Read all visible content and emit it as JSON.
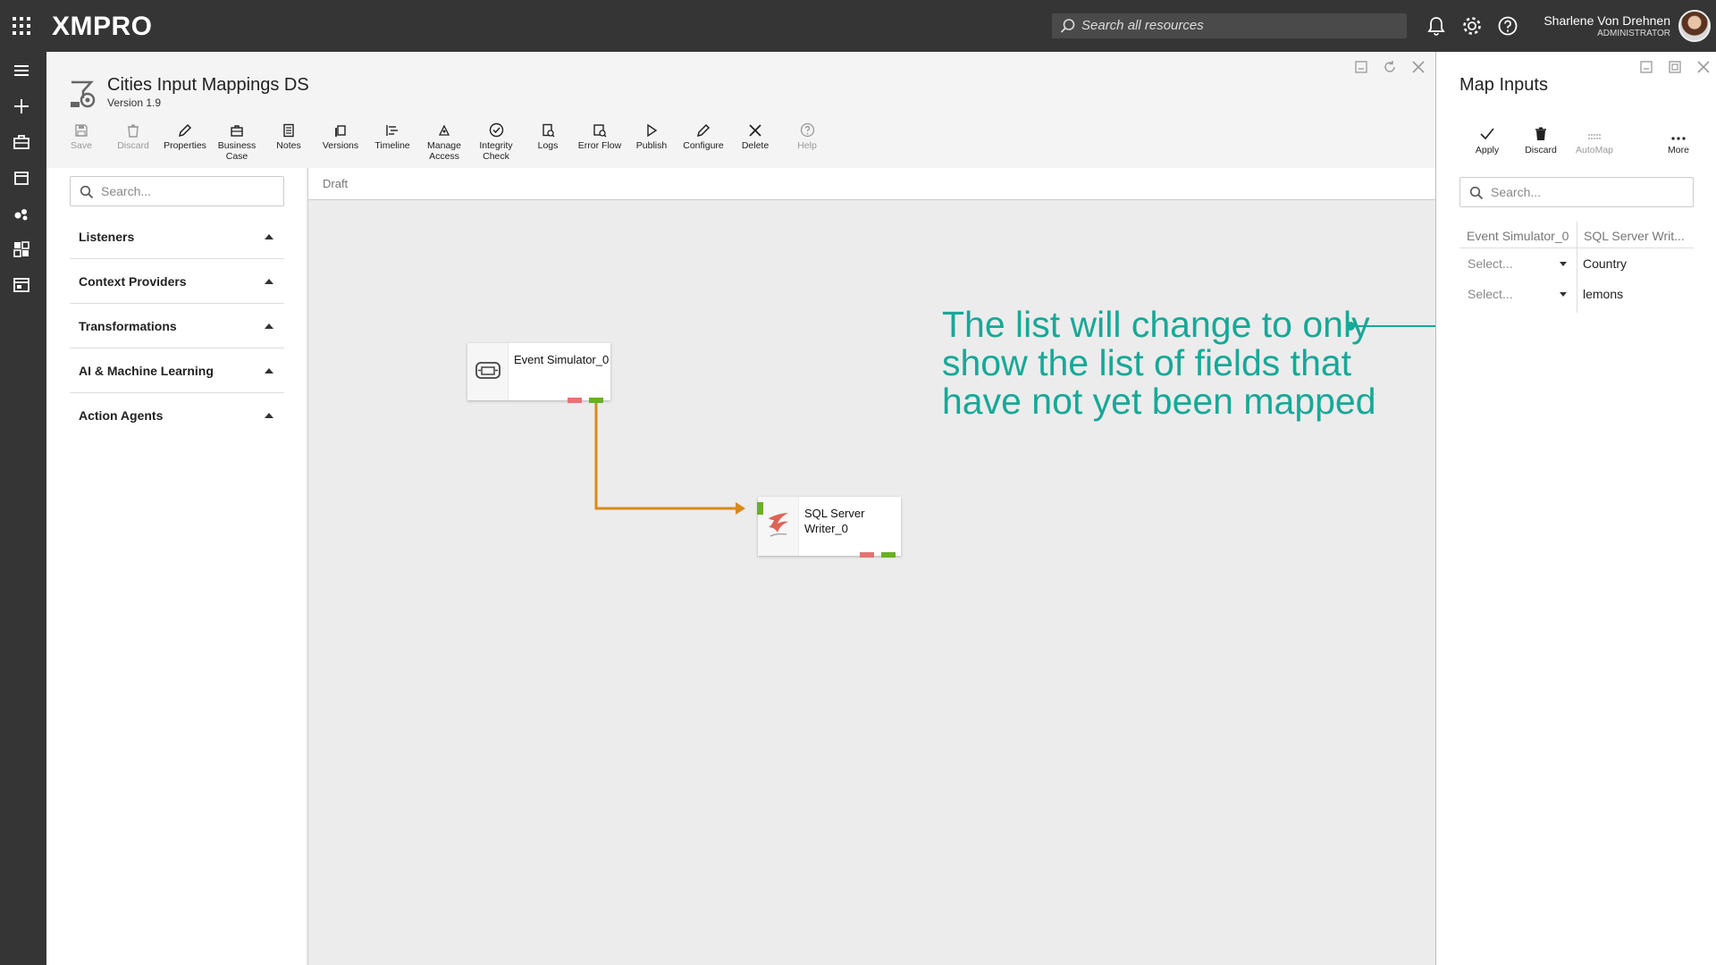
{
  "topbar": {
    "brand": "XMPRO",
    "search_placeholder": "Search all resources",
    "user_name": "Sharlene Von Drehnen",
    "user_role": "ADMINISTRATOR"
  },
  "datastream": {
    "title": "Cities Input Mappings DS",
    "version": "Version 1.9"
  },
  "toolbar": [
    {
      "label": "Save",
      "icon": "save-icon",
      "enabled": false
    },
    {
      "label": "Discard",
      "icon": "trash-icon",
      "enabled": false
    },
    {
      "label": "Properties",
      "icon": "pencil-icon",
      "enabled": true
    },
    {
      "label": "Business Case",
      "icon": "briefcase-icon",
      "enabled": true
    },
    {
      "label": "Notes",
      "icon": "notes-icon",
      "enabled": true
    },
    {
      "label": "Versions",
      "icon": "versions-icon",
      "enabled": true
    },
    {
      "label": "Timeline",
      "icon": "timeline-icon",
      "enabled": true
    },
    {
      "label": "Manage Access",
      "icon": "access-icon",
      "enabled": true
    },
    {
      "label": "Integrity Check",
      "icon": "check-circle-icon",
      "enabled": true
    },
    {
      "label": "Logs",
      "icon": "logs-icon",
      "enabled": true
    },
    {
      "label": "Error Flow",
      "icon": "error-flow-icon",
      "enabled": true
    },
    {
      "label": "Publish",
      "icon": "play-icon",
      "enabled": true
    },
    {
      "label": "Configure",
      "icon": "pencil-icon",
      "enabled": true
    },
    {
      "label": "Delete",
      "icon": "close-icon",
      "enabled": true
    },
    {
      "label": "Help",
      "icon": "help-icon",
      "enabled": false
    }
  ],
  "toolbox": {
    "search_placeholder": "Search...",
    "categories": [
      "Listeners",
      "Context Providers",
      "Transformations",
      "AI & Machine Learning",
      "Action Agents"
    ]
  },
  "canvas": {
    "status": "Draft",
    "nodes": [
      {
        "label": "Event Simulator_0",
        "icon": "simulator-icon"
      },
      {
        "label": "SQL Server Writer_0",
        "icon": "sql-server-icon"
      }
    ],
    "connection_color": "#d98a1a",
    "annotation": "The list will change to only show the list of fields that have not yet been mapped",
    "annotation_color": "#17a898"
  },
  "map_inputs": {
    "title": "Map Inputs",
    "actions": [
      {
        "label": "Apply",
        "icon": "check-icon",
        "enabled": true
      },
      {
        "label": "Discard",
        "icon": "trash-icon",
        "enabled": true
      },
      {
        "label": "AutoMap",
        "icon": "automap-icon",
        "enabled": false
      },
      {
        "label": "More",
        "icon": "more-icon",
        "enabled": true
      }
    ],
    "search_placeholder": "Search...",
    "source_header": "Event Simulator_0",
    "target_header": "SQL Server Writ...",
    "rows": [
      {
        "source": "Select...",
        "target": "Country"
      },
      {
        "source": "Select...",
        "target": "lemons"
      }
    ]
  }
}
